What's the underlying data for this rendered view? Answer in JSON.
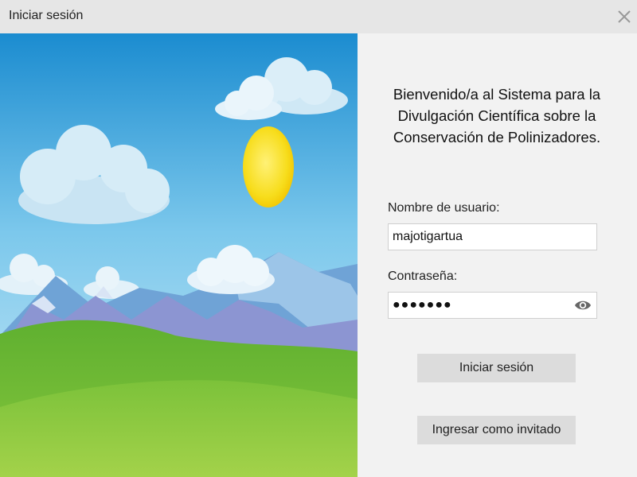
{
  "window": {
    "title": "Iniciar sesión"
  },
  "illustration": {
    "icon": "landscape-illustration"
  },
  "panel": {
    "heading": "Bienvenido/a al Sistema para la Divulgación Científica sobre la Conservación de Polinizadores.",
    "username": {
      "label": "Nombre de usuario:",
      "value": "majotigartua"
    },
    "password": {
      "label": "Contraseña:",
      "value": "●●●●●●●"
    },
    "login_button": "Iniciar sesión",
    "guest_button": "Ingresar como invitado"
  },
  "colors": {
    "sky_top": "#1e8fd2",
    "sky_bottom": "#bfe6f5",
    "sun": "#f8e020",
    "grass": "#6ebd2f"
  }
}
